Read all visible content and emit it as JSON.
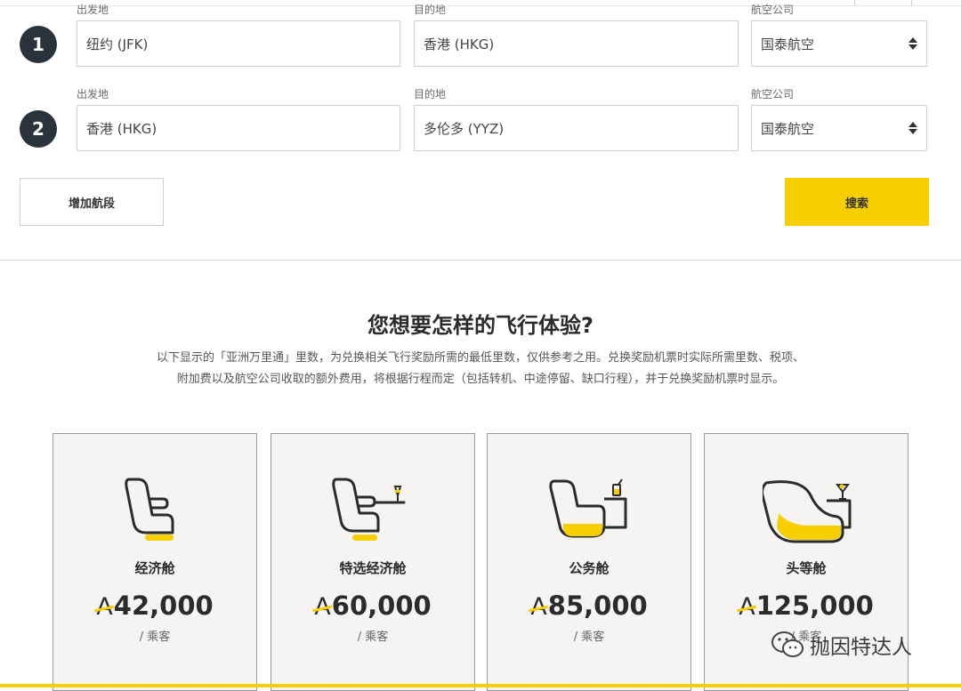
{
  "segments": [
    {
      "num": "1",
      "origin_label": "出发地",
      "origin": "纽约 (JFK)",
      "dest_label": "目的地",
      "dest": "香港 (HKG)",
      "airline_label": "航空公司",
      "airline": "国泰航空"
    },
    {
      "num": "2",
      "origin_label": "出发地",
      "origin": "香港 (HKG)",
      "dest_label": "目的地",
      "dest": "多伦多 (YYZ)",
      "airline_label": "航空公司",
      "airline": "国泰航空"
    }
  ],
  "actions": {
    "add_segment": "增加航段",
    "search": "搜索"
  },
  "section": {
    "title": "您想要怎样的飞行体验?",
    "desc_line1": "以下显示的「亚洲万里通」里数，为兑换相关飞行奖励所需的最低里数，仅供参考之用。兑换奖励机票时实际所需里数、税项、",
    "desc_line2": "附加费以及航空公司收取的额外费用，将根据行程而定（包括转机、中途停留、缺口行程），并于兑换奖励机票时显示。"
  },
  "cabins": [
    {
      "name": "经济舱",
      "miles": "42,000",
      "unit": "/ 乘客",
      "icon": "economy-seat-icon"
    },
    {
      "name": "特选经济舱",
      "miles": "60,000",
      "unit": "/ 乘客",
      "icon": "premium-economy-seat-icon"
    },
    {
      "name": "公务舱",
      "miles": "85,000",
      "unit": "/ 乘客",
      "icon": "business-seat-icon"
    },
    {
      "name": "头等舱",
      "miles": "125,000",
      "unit": "/ 乘客",
      "icon": "first-class-seat-icon"
    }
  ],
  "currency_mark": "A",
  "colors": {
    "accent": "#f7cf00",
    "badge": "#2a333b",
    "card_bg": "#f5f4f2"
  },
  "watermark": {
    "text": "抛因特达人",
    "icon": "wechat-icon"
  }
}
